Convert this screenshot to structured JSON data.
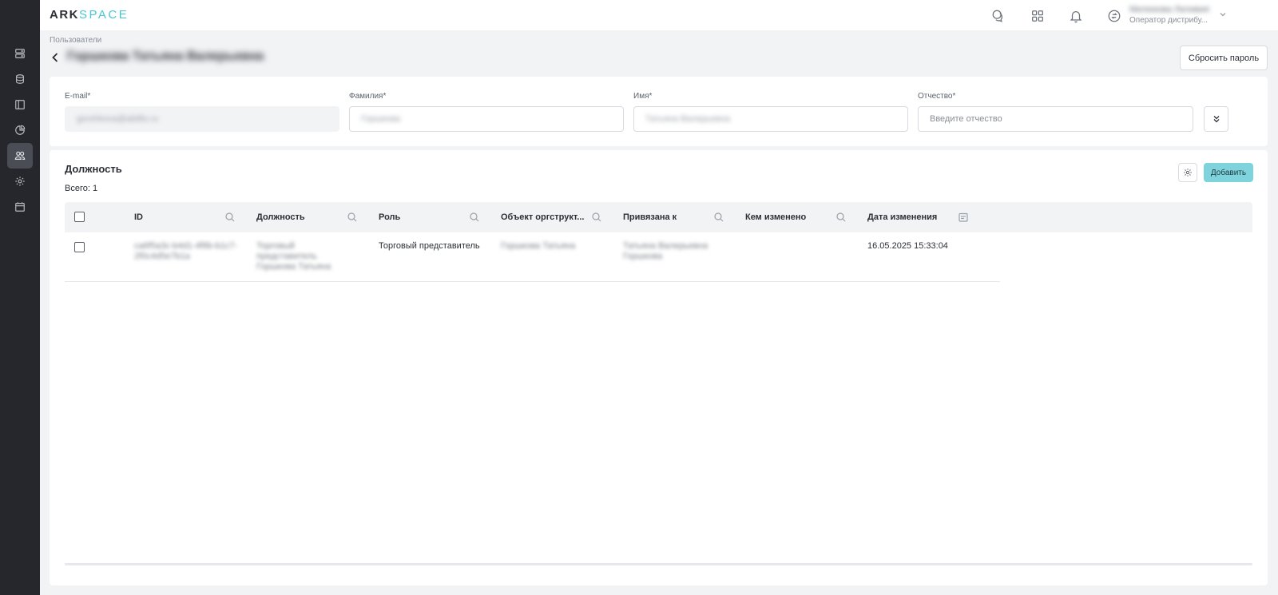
{
  "header": {
    "logo_ark": "ARK",
    "logo_space": "SPACE",
    "user": {
      "name": "Милюкова Лиливия",
      "role": "Оператор дистрибу..."
    }
  },
  "sidebar": {
    "items": [
      {
        "icon": "server-icon",
        "active": false
      },
      {
        "icon": "database-icon",
        "active": false
      },
      {
        "icon": "layout-icon",
        "active": false
      },
      {
        "icon": "pie-chart-icon",
        "active": false
      },
      {
        "icon": "users-icon",
        "active": true
      },
      {
        "icon": "gear-icon",
        "active": false
      },
      {
        "icon": "calendar-icon",
        "active": false
      }
    ]
  },
  "page": {
    "breadcrumb": "Пользователи",
    "title": "Горшкова Татьяна Валерьевна",
    "reset_password_label": "Сбросить пароль"
  },
  "form": {
    "email": {
      "label": "E-mail*",
      "value": "gorshkova@abillis.ru"
    },
    "last_name": {
      "label": "Фамилия*",
      "value": "Горшкова"
    },
    "first_name": {
      "label": "Имя*",
      "value": "Татьяна Валерьевна"
    },
    "middle_name": {
      "label": "Отчество*",
      "placeholder": "Введите отчество"
    }
  },
  "positions": {
    "title": "Должность",
    "total": "Всего: 1",
    "add_label": "Добавить",
    "columns": [
      "ID",
      "Должность",
      "Роль",
      "Объект оргструкт...",
      "Привязана к",
      "Кем изменено",
      "Дата изменения"
    ],
    "rows": [
      {
        "id": "ca6f5a3c-b4d1-4f8b-b1c7-2f0c4d5e7b1a",
        "position": "Торговый представитель Горшкова Татьяна",
        "role": "Торговый представитель",
        "org_object": "Горшкова Татьяна",
        "bound_to": "Татьяна Валерьевна Горшкова",
        "changed_by": "",
        "changed_at": "16.05.2025 15:33:04"
      }
    ]
  },
  "colors": {
    "sidebar_bg": "#25272c",
    "accent": "#7fd3dc",
    "logo_accent": "#4ac6d2"
  }
}
